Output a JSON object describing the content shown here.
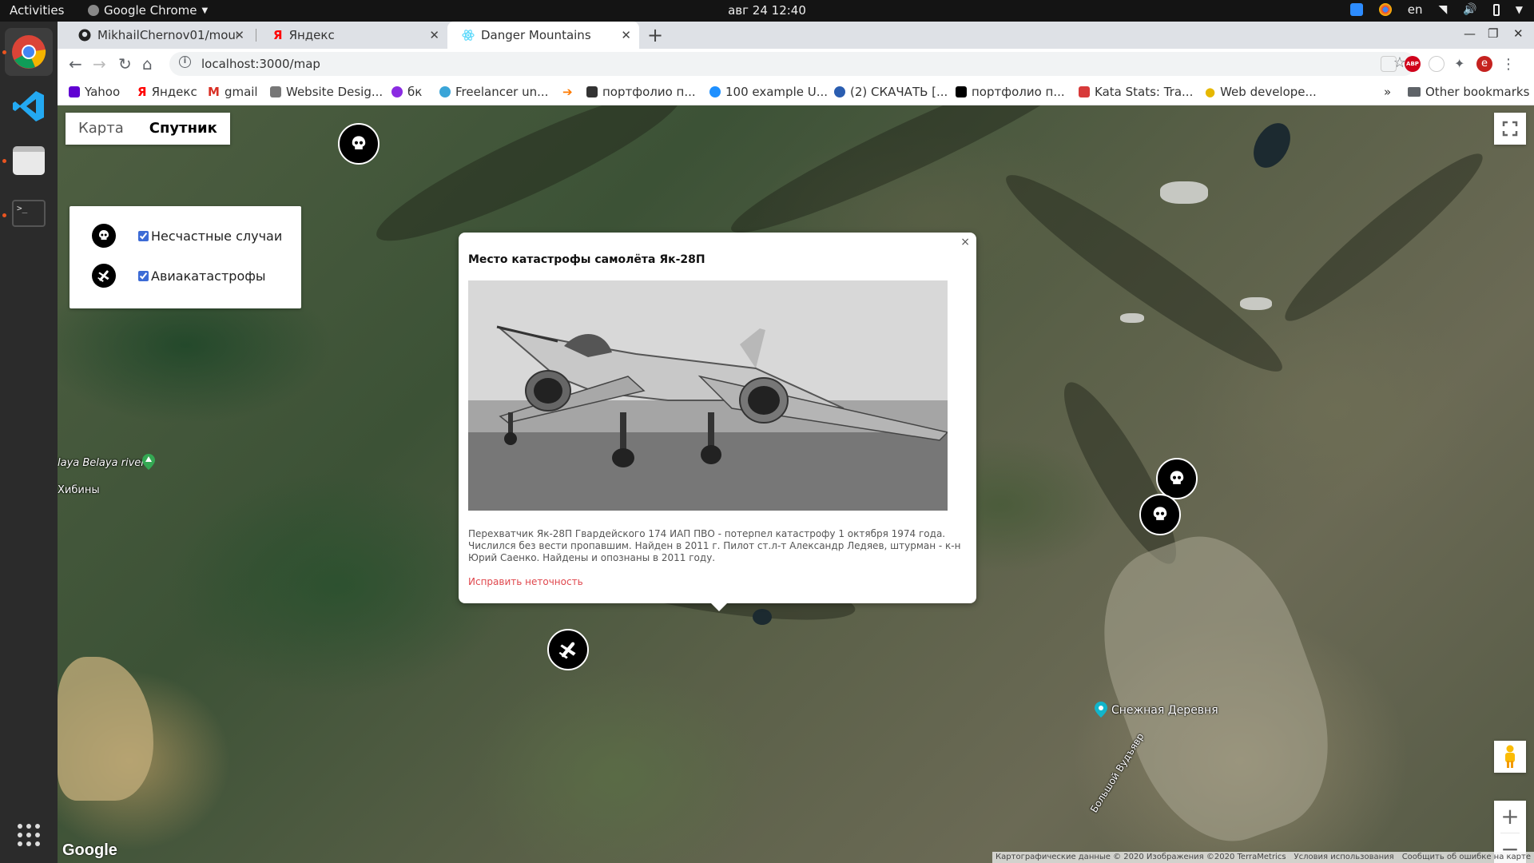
{
  "topbar": {
    "activities": "Activities",
    "app_menu": "Google Chrome",
    "clock": "авг 24  12:40",
    "lang": "en"
  },
  "browser": {
    "tabs": [
      {
        "title": "MikhailChernov01/mount",
        "icon": "github-icon"
      },
      {
        "title": "Яндекс",
        "icon": "yandex-icon"
      },
      {
        "title": "Danger Mountains",
        "icon": "react-icon"
      }
    ],
    "url": "localhost:3000/map",
    "bookmarks": [
      {
        "label": "Yahoo",
        "color": "#6001d2"
      },
      {
        "label": "Яндекс",
        "color": "#ff0000"
      },
      {
        "label": "gmail",
        "color": "#d93025"
      },
      {
        "label": "Website Desig...",
        "color": "#555555"
      },
      {
        "label": "бк",
        "color": "#8a2be2"
      },
      {
        "label": "Freelancer un...",
        "color": "#3aa5d8"
      },
      {
        "label": "",
        "color": "#ff7a00"
      },
      {
        "label": "портфолио п...",
        "color": "#333333"
      },
      {
        "label": "100 example U...",
        "color": "#1e90ff"
      },
      {
        "label": "(2) СКАЧАТЬ [...",
        "color": "#2a5db0"
      },
      {
        "label": "портфолио п...",
        "color": "#000000"
      },
      {
        "label": "Kata Stats: Tra...",
        "color": "#d73a3a"
      },
      {
        "label": "Web develope...",
        "color": "#e6b800"
      }
    ],
    "other_bookmarks": "Other bookmarks",
    "profile_initial": "e"
  },
  "map": {
    "type_control": {
      "map": "Карта",
      "satellite": "Спутник"
    },
    "legend": {
      "accidents": "Несчастные случаи",
      "plane_crashes": "Авиакатастрофы"
    },
    "places": {
      "river": "laya Belaya river",
      "khibiny": "Хибины",
      "village": "Снежная Деревня",
      "river2": "Большой Вудъявр"
    },
    "popup": {
      "close": "×",
      "title": "Место катастрофы самолёта Як-28П",
      "text": "Перехватчик Як-28П Гвардейского 174 ИАП ПВО - потерпел катастрофу 1 октября 1974 года. Числился без вести пропавшим. Найден в 2011 г. Пилот ст.л-т Александр Ледяев, штурман - к-н Юрий Саенко. Найдены и опознаны в 2011 году.",
      "link": "Исправить неточность"
    },
    "google": "Google",
    "attribution": [
      "Картографические данные © 2020 Изображения ©2020 TerraMetrics",
      "Условия использования",
      "Сообщить об ошибке на карте"
    ]
  }
}
